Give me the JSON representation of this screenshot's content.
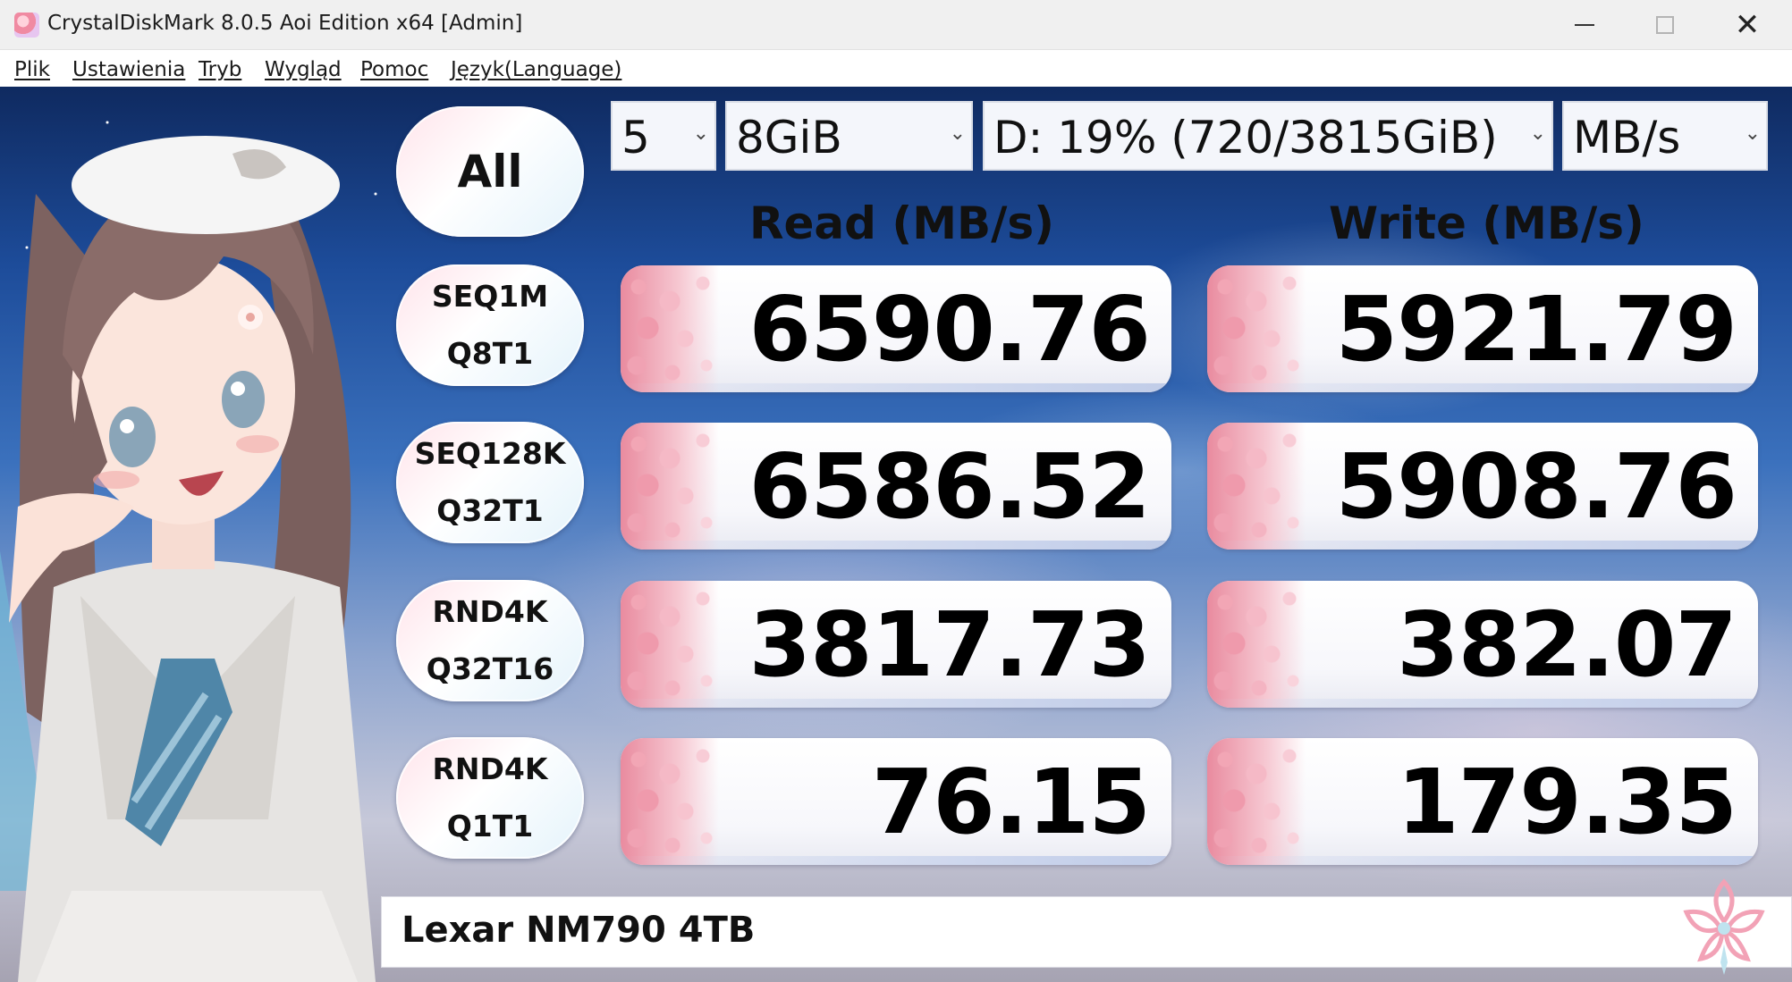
{
  "window": {
    "title": "CrystalDiskMark 8.0.5 Aoi Edition x64 [Admin]"
  },
  "menu": {
    "items": [
      "Plik",
      "Ustawienia",
      "Tryb",
      "Wygląd",
      "Pomoc",
      "Język(Language)"
    ]
  },
  "controls": {
    "all_label": "All",
    "count": "5",
    "size": "8GiB",
    "drive": "D: 19% (720/3815GiB)",
    "unit": "MB/s"
  },
  "headers": {
    "read": "Read (MB/s)",
    "write": "Write (MB/s)"
  },
  "tests": [
    {
      "line1": "SEQ1M",
      "line2": "Q8T1",
      "read": "6590.76",
      "write": "5921.79"
    },
    {
      "line1": "SEQ128K",
      "line2": "Q32T1",
      "read": "6586.52",
      "write": "5908.76"
    },
    {
      "line1": "RND4K",
      "line2": "Q32T16",
      "read": "3817.73",
      "write": "382.07"
    },
    {
      "line1": "RND4K",
      "line2": "Q1T1",
      "read": "76.15",
      "write": "179.35"
    }
  ],
  "footer": {
    "drive_label": "Lexar NM790 4TB"
  },
  "icons": {
    "app": "crystaldiskmark-app-icon",
    "minimize": "minimize-icon",
    "maximize": "maximize-icon",
    "close": "close-icon",
    "dropdown": "chevron-down-icon",
    "logo": "sakura-logo-icon"
  },
  "colors": {
    "accent_pink": "#f08aa2",
    "sky_blue": "#3b71bd"
  }
}
